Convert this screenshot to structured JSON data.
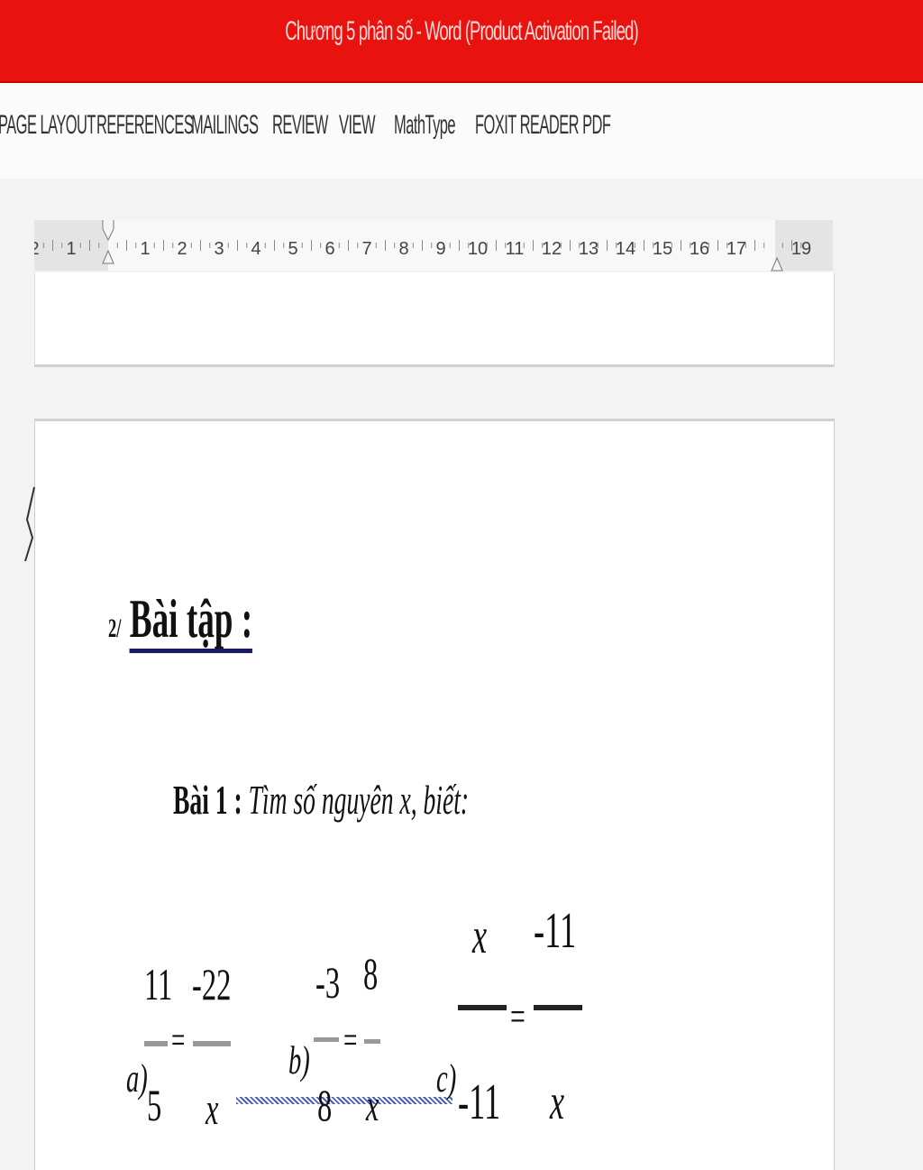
{
  "window": {
    "title": "Chương 5 phân số - Word (Product Activation Failed)"
  },
  "ribbon": {
    "tabs": [
      "PAGE LAYOUT",
      "REFERENCES",
      "MAILINGS",
      "REVIEW",
      "VIEW",
      "MathType",
      "FOXIT READER PDF"
    ]
  },
  "ruler": {
    "left_labels": [
      "2",
      "1"
    ],
    "labels": [
      "1",
      "2",
      "3",
      "4",
      "5",
      "6",
      "7",
      "8",
      "9",
      "10",
      "11",
      "12",
      "13",
      "14",
      "15",
      "16",
      "17"
    ],
    "end_label": "19"
  },
  "document": {
    "heading_number": "2/",
    "heading_text": "Bài tập :",
    "exercise_label": "Bài 1 :",
    "exercise_text": "Tìm số nguyên x, biết:",
    "eq_a": {
      "label": "a)",
      "n1": "11",
      "d1": "5",
      "n2": "-22",
      "d2": "x",
      "op": "="
    },
    "eq_b": {
      "label": "b)",
      "n1": "-3",
      "d1": "8",
      "n2": "8",
      "d2": "x",
      "op": "="
    },
    "eq_c": {
      "label": "c)",
      "n1": "x",
      "d1": "-11",
      "n2": "-11",
      "d2": "x",
      "op": "="
    }
  }
}
